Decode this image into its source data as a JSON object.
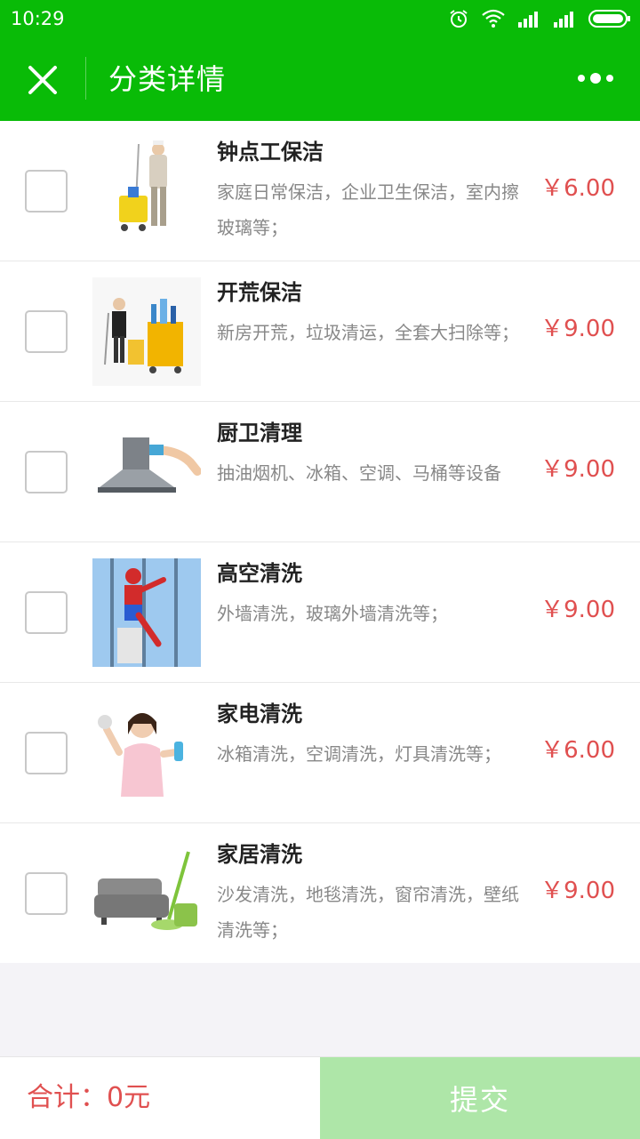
{
  "status_bar": {
    "time": "10:29"
  },
  "header": {
    "title": "分类详情"
  },
  "items": [
    {
      "title": "钟点工保洁",
      "desc": "家庭日常保洁，企业卫生保洁，室内擦玻璃等；",
      "price": "￥6.00"
    },
    {
      "title": "开荒保洁",
      "desc": "新房开荒，垃圾清运，全套大扫除等；",
      "price": "￥9.00"
    },
    {
      "title": "厨卫清理",
      "desc": "抽油烟机、冰箱、空调、马桶等设备",
      "price": "￥9.00"
    },
    {
      "title": "高空清洗",
      "desc": "外墙清洗，玻璃外墙清洗等；",
      "price": "￥9.00"
    },
    {
      "title": "家电清洗",
      "desc": "冰箱清洗，空调清洗，灯具清洗等；",
      "price": "￥6.00"
    },
    {
      "title": "家居清洗",
      "desc": "沙发清洗，地毯清洗，窗帘清洗，壁纸清洗等；",
      "price": "￥9.00"
    }
  ],
  "footer": {
    "total": "合计：0元",
    "submit_label": "提交"
  },
  "colors": {
    "brand": "#09bb07",
    "price": "#e05050",
    "submit_disabled": "#aee6a8"
  }
}
